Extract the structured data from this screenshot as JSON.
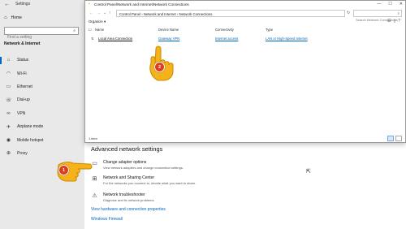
{
  "settings": {
    "title": "Settings",
    "home_label": "Home",
    "search_placeholder": "Find a setting",
    "section_header": "Network & Internet",
    "nav_items": [
      {
        "label": "Status",
        "icon": "home-icon"
      },
      {
        "label": "Wi-Fi",
        "icon": "wifi-icon"
      },
      {
        "label": "Ethernet",
        "icon": "ethernet-icon"
      },
      {
        "label": "Dial-up",
        "icon": "phone-icon"
      },
      {
        "label": "VPN",
        "icon": "vpn-icon"
      },
      {
        "label": "Airplane mode",
        "icon": "airplane-icon"
      },
      {
        "label": "Mobile hotspot",
        "icon": "hotspot-icon"
      },
      {
        "label": "Proxy",
        "icon": "globe-icon"
      }
    ],
    "main_heading": "Advanced network settings",
    "options": [
      {
        "title": "Change adapter options",
        "desc": "View network adapters and change connection settings."
      },
      {
        "title": "Network and Sharing Center",
        "desc": "For the networks you connect to, decide what you want to share."
      },
      {
        "title": "Network troubleshooter",
        "desc": "Diagnose and fix network problems."
      }
    ],
    "links": [
      "View hardware and connection properties",
      "Windows Firewall"
    ]
  },
  "control_panel": {
    "title": "Control Panel\\Network and Internet\\Network Connections",
    "address": "Control Panel  ›  Network and Internet  ›  Network Connections",
    "search_placeholder": "Search Network Connections",
    "organize_label": "Organize ▾",
    "columns": [
      "Name",
      "Device Name",
      "Connectivity",
      "Type"
    ],
    "rows": [
      {
        "name": "Local Area Connection",
        "device": "Gateway VPN",
        "connectivity": "Internet access",
        "type": "LAN or High-Speed Internet"
      }
    ],
    "status": "1 item"
  },
  "markers": [
    "1",
    "2"
  ],
  "colors": {
    "accent": "#0067c0",
    "marker": "#e03c1c",
    "hand": "#f5b21a"
  }
}
